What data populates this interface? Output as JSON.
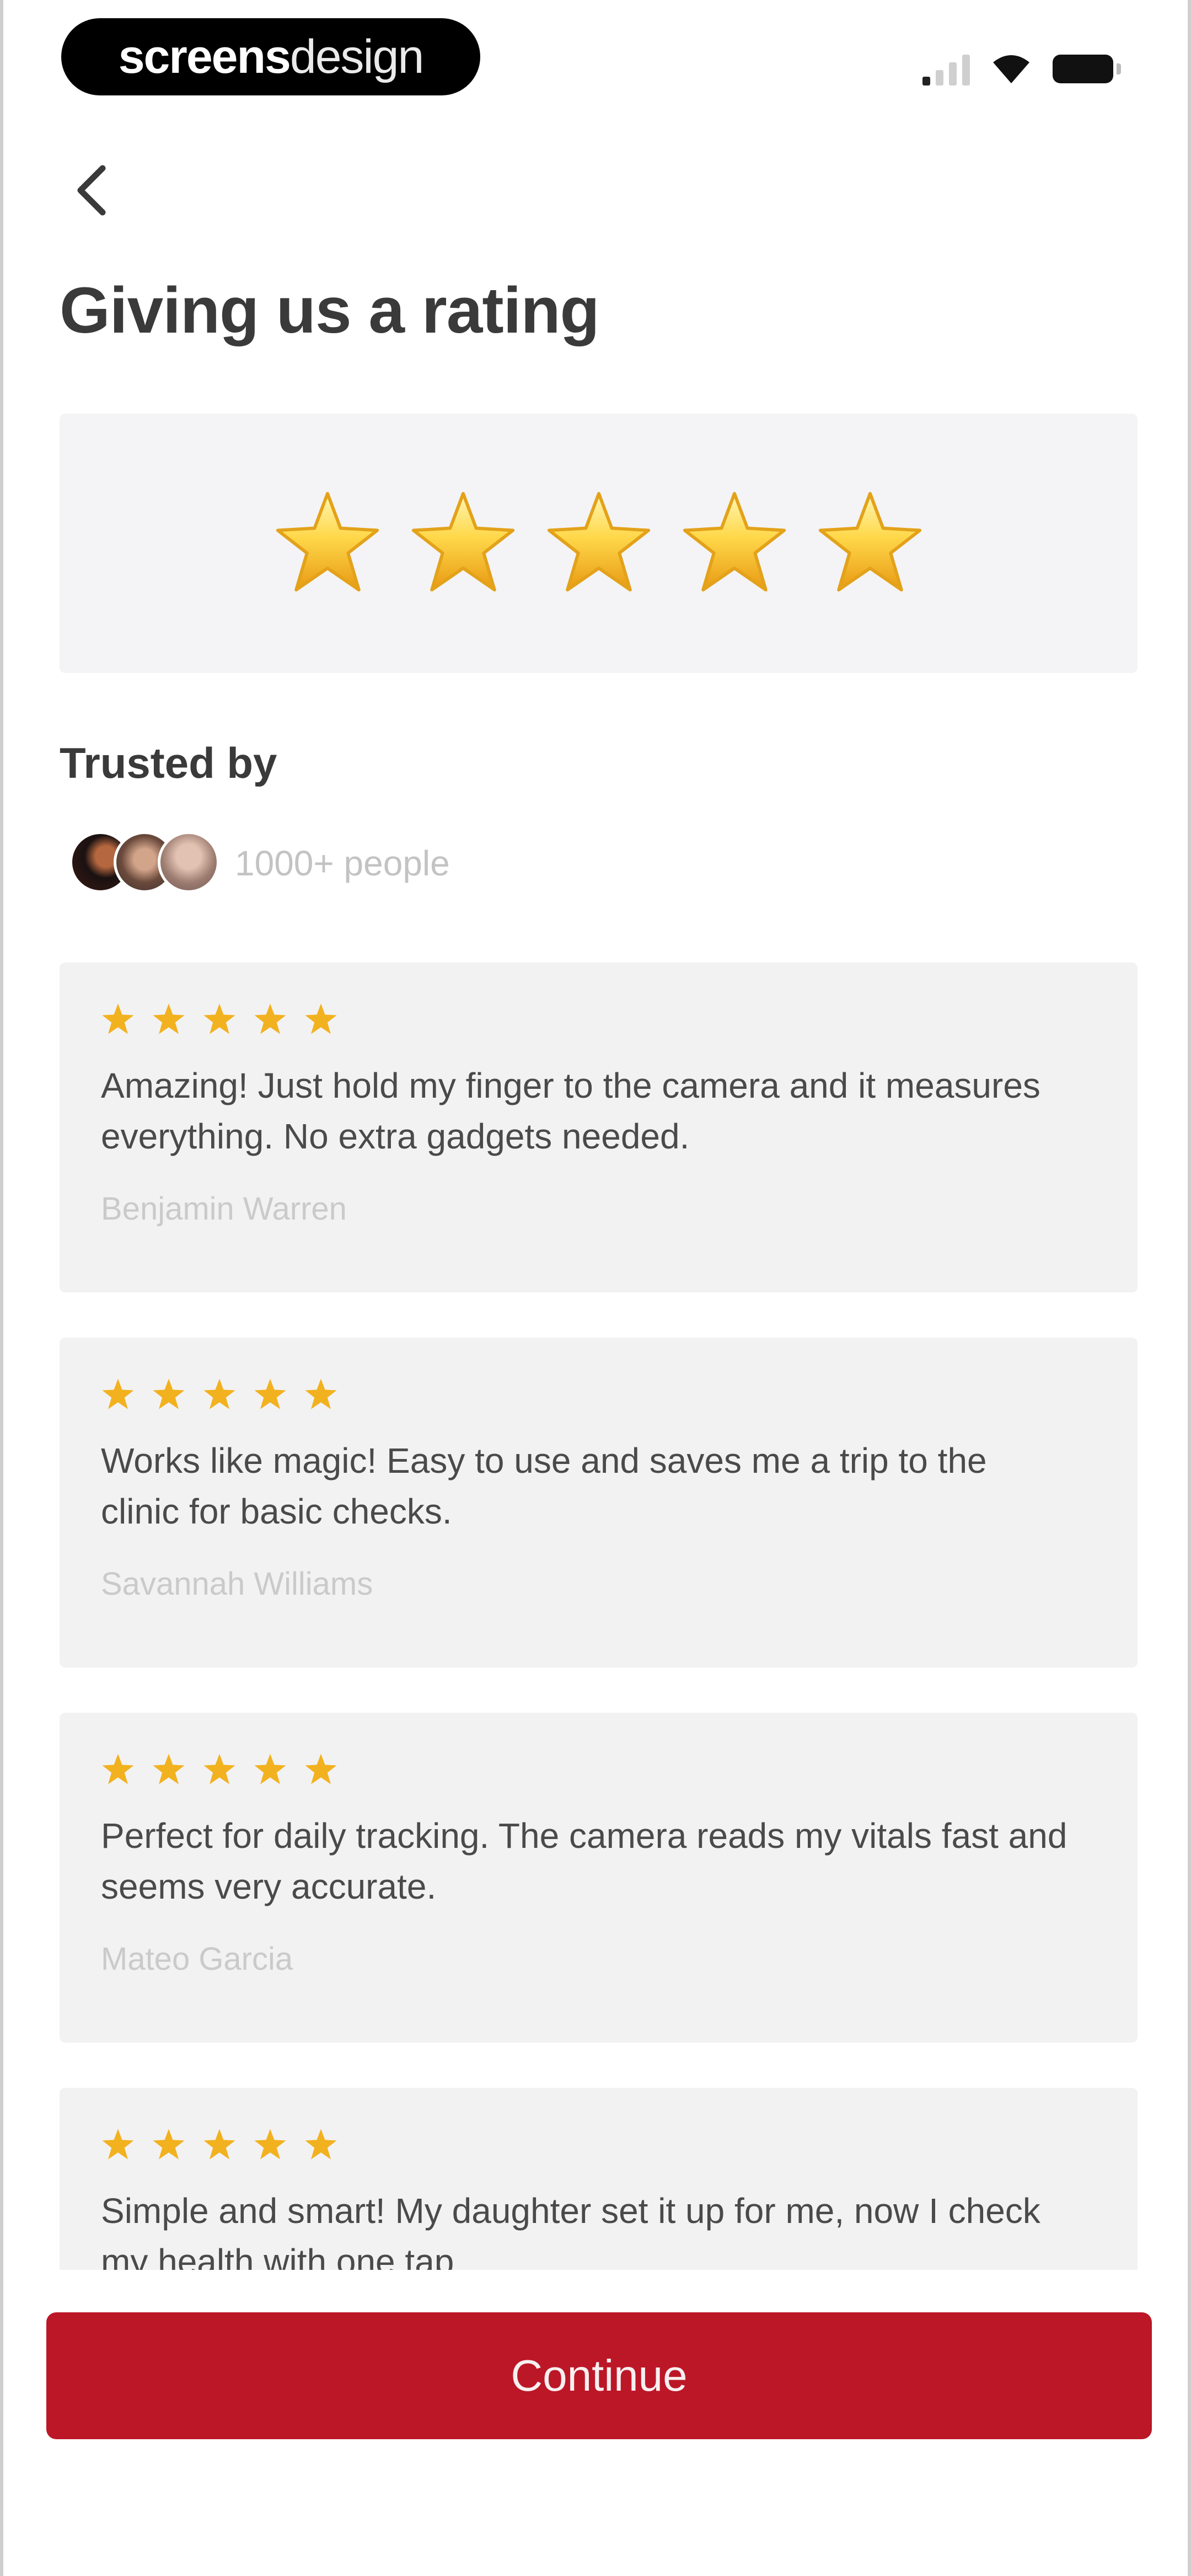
{
  "status_bar": {
    "brand_bold": "screens",
    "brand_light": "design"
  },
  "header": {
    "title": "Giving us a rating"
  },
  "rating": {
    "stars": 5
  },
  "trusted": {
    "heading": "Trusted by",
    "people": "1000+ people"
  },
  "reviews": [
    {
      "stars": 5,
      "text": "Amazing! Just hold my finger to the camera and it measures everything. No extra gadgets needed.",
      "author": "Benjamin Warren"
    },
    {
      "stars": 5,
      "text": "Works like magic! Easy to use and saves me a trip to the clinic for basic checks.",
      "author": "Savannah Williams"
    },
    {
      "stars": 5,
      "text": "Perfect for daily tracking. The camera reads my vitals fast and seems very accurate.",
      "author": "Mateo Garcia"
    },
    {
      "stars": 5,
      "text": "Simple and smart! My daughter set it up for me, now I check my health with one tap.",
      "author": ""
    }
  ],
  "footer": {
    "continue_label": "Continue"
  },
  "colors": {
    "accent": "#bc1727",
    "star": "#f2b11f",
    "card_bg": "#f2f2f2"
  },
  "icons": {
    "back": "chevron-left-icon",
    "star": "star-icon",
    "signal": "cellular-signal-icon",
    "wifi": "wifi-icon",
    "battery": "battery-icon"
  }
}
